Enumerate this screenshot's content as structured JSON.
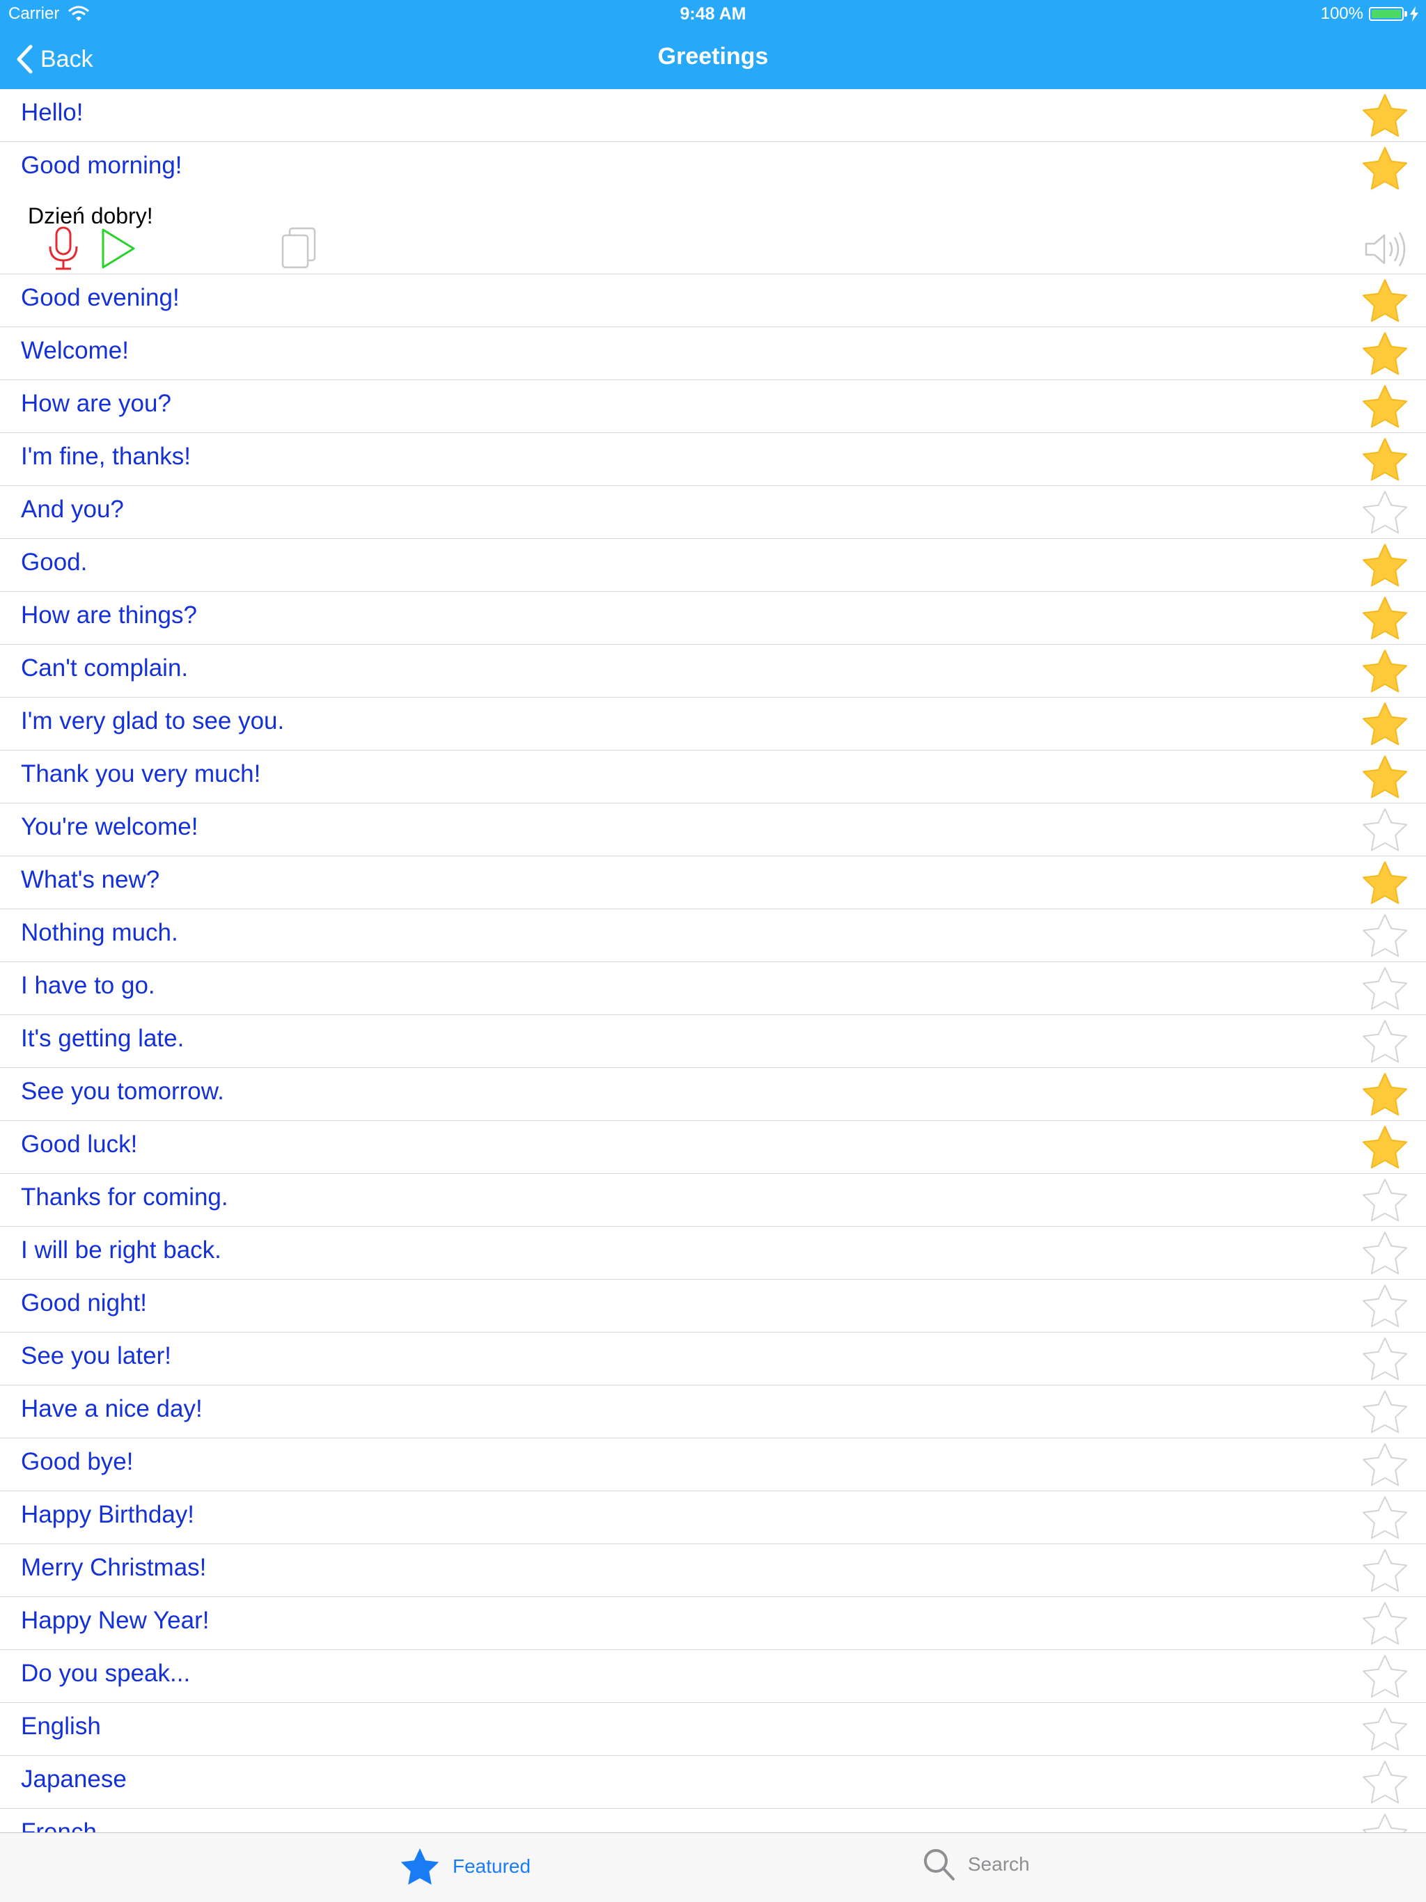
{
  "status_bar": {
    "carrier": "Carrier",
    "time": "9:48 AM",
    "battery": "100%"
  },
  "nav": {
    "back_label": "Back",
    "title": "Greetings"
  },
  "colors": {
    "accent": "#28a8f8",
    "phrase_text": "#1430d8",
    "star_fill": "#ffc93c",
    "star_outline": "#d4d4d4",
    "tab_active": "#1a7cf5",
    "tab_inactive": "#8e8e93"
  },
  "expanded": {
    "translation": "Dzień dobry!",
    "icons": [
      "microphone-icon",
      "play-icon",
      "copy-icon",
      "speaker-icon"
    ]
  },
  "phrases": [
    {
      "text": "Hello!",
      "starred": true
    },
    {
      "text": "Good morning!",
      "starred": true
    },
    {
      "text": "Good evening!",
      "starred": true
    },
    {
      "text": "Welcome!",
      "starred": true
    },
    {
      "text": "How are you?",
      "starred": true
    },
    {
      "text": "I'm fine, thanks!",
      "starred": true
    },
    {
      "text": "And you?",
      "starred": false
    },
    {
      "text": "Good.",
      "starred": true
    },
    {
      "text": "How are things?",
      "starred": true
    },
    {
      "text": "Can't complain.",
      "starred": true
    },
    {
      "text": "I'm very glad to see you.",
      "starred": true
    },
    {
      "text": "Thank you very much!",
      "starred": true
    },
    {
      "text": "You're welcome!",
      "starred": false
    },
    {
      "text": "What's new?",
      "starred": true
    },
    {
      "text": "Nothing much.",
      "starred": false
    },
    {
      "text": "I have to go.",
      "starred": false
    },
    {
      "text": "It's getting late.",
      "starred": false
    },
    {
      "text": "See you tomorrow.",
      "starred": true
    },
    {
      "text": "Good luck!",
      "starred": true
    },
    {
      "text": "Thanks for coming.",
      "starred": false
    },
    {
      "text": "I will be right back.",
      "starred": false
    },
    {
      "text": "Good night!",
      "starred": false
    },
    {
      "text": "See you later!",
      "starred": false
    },
    {
      "text": "Have a nice day!",
      "starred": false
    },
    {
      "text": "Good bye!",
      "starred": false
    },
    {
      "text": "Happy Birthday!",
      "starred": false
    },
    {
      "text": "Merry Christmas!",
      "starred": false
    },
    {
      "text": "Happy New Year!",
      "starred": false
    },
    {
      "text": "Do you speak...",
      "starred": false
    },
    {
      "text": "English",
      "starred": false
    },
    {
      "text": "Japanese",
      "starred": false
    },
    {
      "text": "French",
      "starred": false
    }
  ],
  "tabbar": {
    "featured_label": "Featured",
    "search_label": "Search"
  }
}
